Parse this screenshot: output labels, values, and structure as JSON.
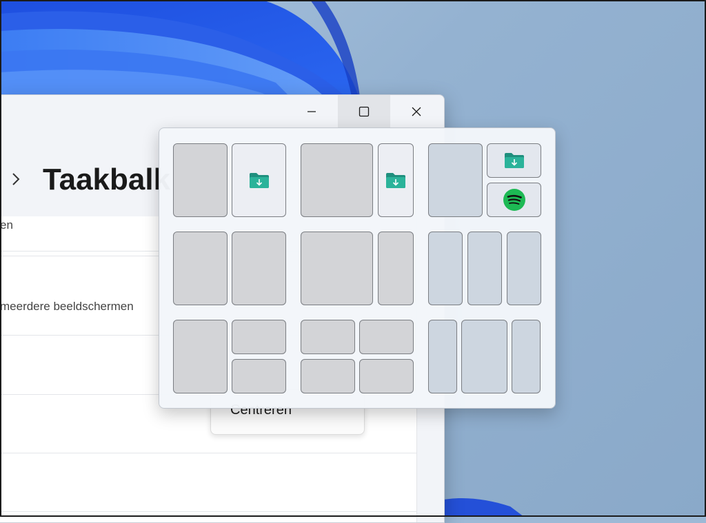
{
  "window": {
    "minimize_icon": "minimize-icon",
    "maximize_icon": "maximize-icon",
    "close_icon": "close-icon",
    "title": "Taakbalk",
    "rows": [
      "en",
      "meerdere beeldschermen"
    ],
    "dropdown_value": "Centreren"
  },
  "snap_layouts": {
    "groups": [
      {
        "layout": "two-columns",
        "zones": [
          "left",
          "right"
        ],
        "apps": {
          "right": "downloads-folder-icon"
        }
      },
      {
        "layout": "wide-left-narrow-right",
        "zones": [
          "left",
          "right"
        ],
        "apps": {
          "right": "downloads-folder-icon"
        }
      },
      {
        "layout": "left-and-two-stacked-right",
        "zones": [
          "left",
          "top-right",
          "bottom-right"
        ],
        "apps": {
          "top-right": "downloads-folder-icon",
          "bottom-right": "spotify-icon"
        }
      },
      {
        "layout": "two-columns",
        "zones": [
          "left",
          "right"
        ]
      },
      {
        "layout": "wide-left-narrow-right",
        "zones": [
          "left",
          "right"
        ]
      },
      {
        "layout": "three-columns",
        "zones": [
          "left",
          "center",
          "right"
        ]
      },
      {
        "layout": "left-and-two-stacked-right",
        "zones": [
          "left",
          "top-right",
          "bottom-right"
        ]
      },
      {
        "layout": "four-quadrants",
        "zones": [
          "top-left",
          "top-right",
          "bottom-left",
          "bottom-right"
        ]
      },
      {
        "layout": "narrow-wide-narrow",
        "zones": [
          "left",
          "center",
          "right"
        ]
      }
    ]
  },
  "colors": {
    "folder": "#2a9d8f",
    "spotify": "#1db954",
    "accent_blue": "#2f5de6"
  }
}
